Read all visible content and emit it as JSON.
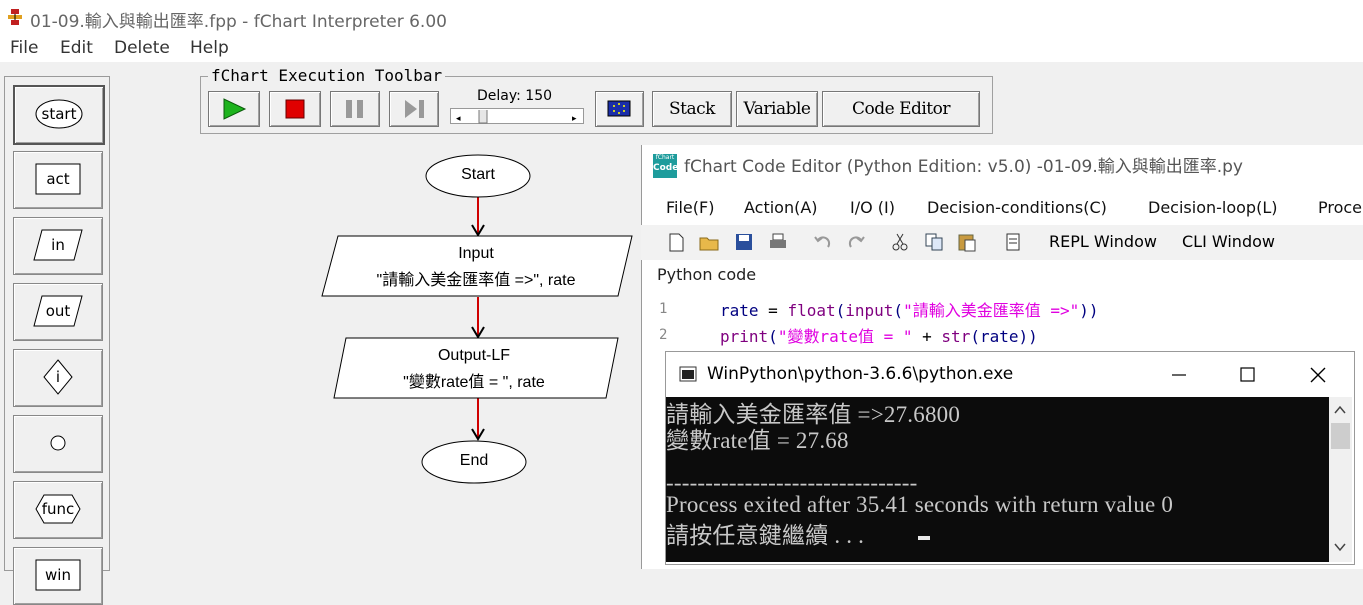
{
  "window": {
    "title": "01-09.輸入與輸出匯率.fpp - fChart Interpreter 6.00",
    "icon": "fchart-app-icon"
  },
  "menu": [
    "File",
    "Edit",
    "Delete",
    "Help"
  ],
  "palette": {
    "items": [
      "start",
      "act",
      "in",
      "out",
      "i",
      "",
      "func",
      "win"
    ]
  },
  "exec_toolbar": {
    "title": "fChart Execution Toolbar",
    "delay_label": "Delay: 150",
    "buttons": {
      "stack": "Stack",
      "variable": "Variable",
      "code_editor": "Code Editor"
    },
    "colors": {
      "run": "#1db31d",
      "stop": "#e00000"
    }
  },
  "flowchart": {
    "start": "Start",
    "input_title": "Input",
    "input_body": "\"請輸入美金匯率值 =>\", rate",
    "output_title": "Output-LF",
    "output_body": "\"變數rate值 = \", rate",
    "end": "End"
  },
  "code_editor": {
    "title": "fChart Code Editor (Python Edition:  v5.0) -01-09.輸入與輸出匯率.py",
    "app_icon_text_top": "fChart",
    "app_icon_text_bottom": "Code",
    "menu": [
      "File(F)",
      "Action(A)",
      "I/O (I)",
      "Decision-conditions(C)",
      "Decision-loop(L)",
      "Proce"
    ],
    "toolbar": {
      "repl": "REPL Window",
      "cli": "CLI Window"
    },
    "section_label": "Python code",
    "lines": [
      {
        "num": "1",
        "parts": [
          {
            "t": "rate",
            "c": "#000080"
          },
          {
            "t": " = ",
            "c": "#000000"
          },
          {
            "t": "float",
            "c": "#7f007f"
          },
          {
            "t": "(",
            "c": "#000080"
          },
          {
            "t": "input",
            "c": "#7f007f"
          },
          {
            "t": "(",
            "c": "#000080"
          },
          {
            "t": "\"請輸入美金匯率值 =>\"",
            "c": "#e000e0"
          },
          {
            "t": "))",
            "c": "#000080"
          }
        ]
      },
      {
        "num": "2",
        "parts": [
          {
            "t": "print",
            "c": "#7f007f"
          },
          {
            "t": "(",
            "c": "#000080"
          },
          {
            "t": "\"變數rate值 = \"",
            "c": "#e000e0"
          },
          {
            "t": " + ",
            "c": "#000000"
          },
          {
            "t": "str",
            "c": "#7f007f"
          },
          {
            "t": "(",
            "c": "#000080"
          },
          {
            "t": "rate",
            "c": "#000080"
          },
          {
            "t": "))",
            "c": "#000080"
          }
        ]
      }
    ]
  },
  "console": {
    "title": "WinPython\\python-3.6.6\\python.exe",
    "lines": [
      "請輸入美金匯率值 =>27.6800",
      "變數rate值 = 27.68",
      "",
      "--------------------------------",
      "Process exited after 35.41 seconds with return value 0",
      "請按任意鍵繼續 . . . "
    ]
  }
}
